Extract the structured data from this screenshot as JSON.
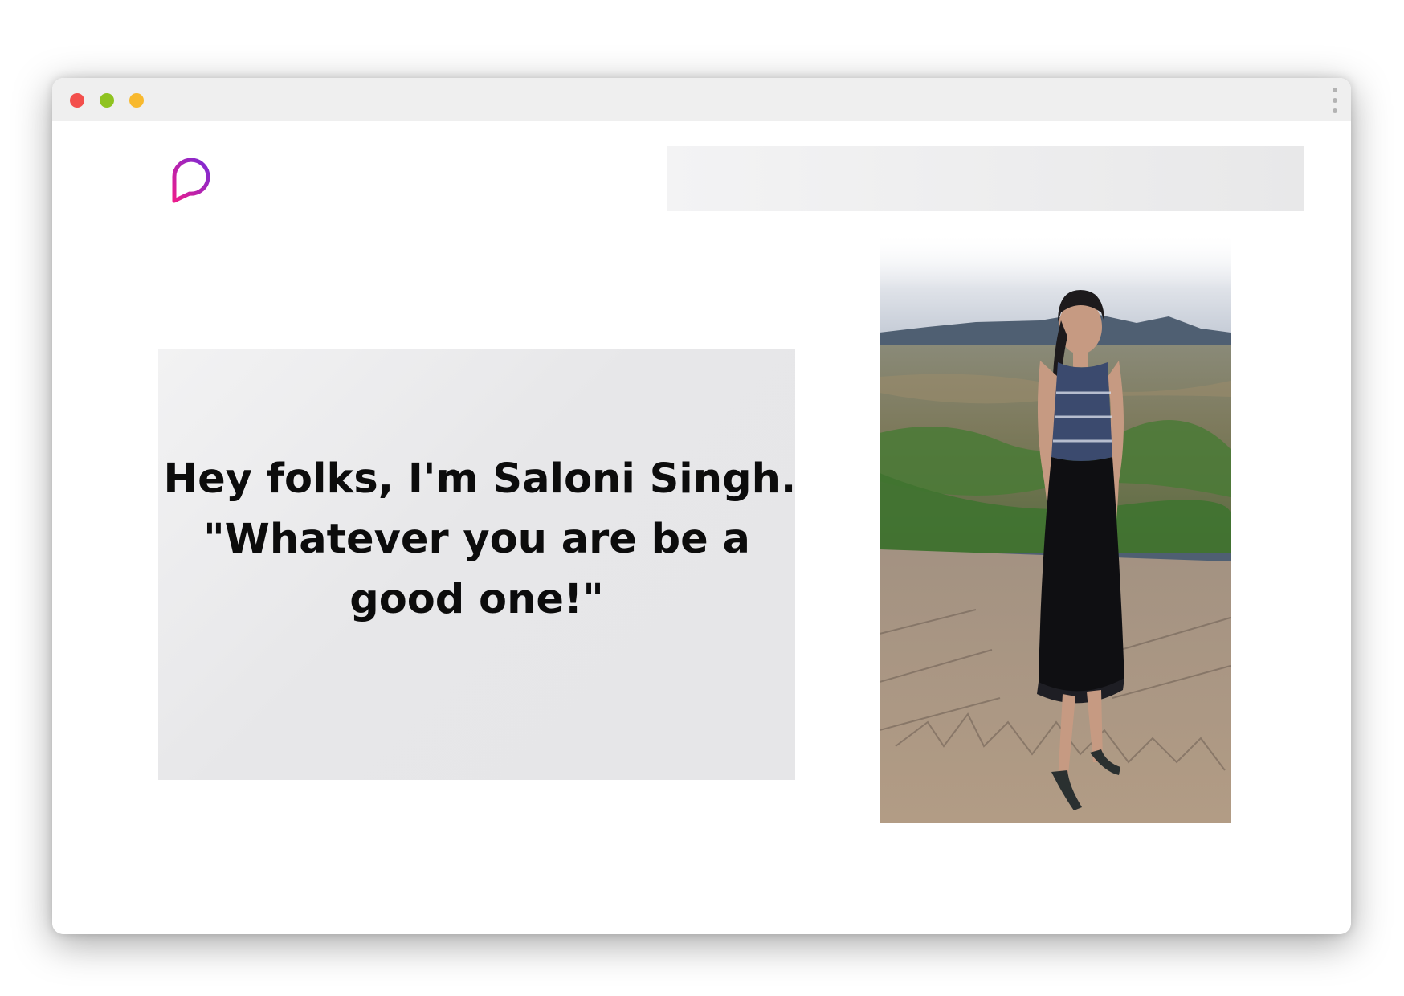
{
  "window": {
    "controls": [
      "close",
      "minimize",
      "zoom"
    ],
    "menu_icon": "more-vertical-icon"
  },
  "header": {
    "logo_icon": "chat-bubble-logo-icon",
    "logo_colors": [
      "#ec1c8c",
      "#7a2bd6"
    ]
  },
  "hero": {
    "quote_lines": [
      "Hey folks, I'm Saloni Singh.",
      "\"Whatever you are be a",
      "good one!\""
    ],
    "photo_icon": "person-standing-photo"
  },
  "colors": {
    "close": "#f34f4c",
    "minimize": "#8fc320",
    "zoom": "#f8b92e",
    "text": "#0c0c0c",
    "panel": "#e8e8e9"
  }
}
